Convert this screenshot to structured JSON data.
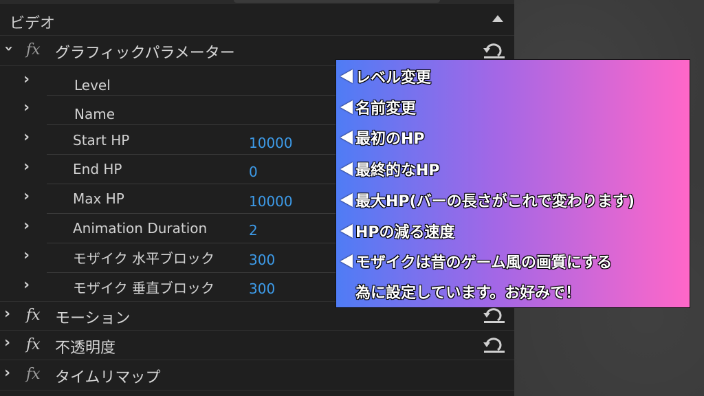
{
  "panel": {
    "section_title": "ビデオ",
    "effects": [
      {
        "name": "グラフィックパラメーター",
        "expanded": true
      },
      {
        "name": "モーション",
        "expanded": false
      },
      {
        "name": "不透明度",
        "expanded": false
      },
      {
        "name": "タイムリマップ",
        "expanded": false
      }
    ],
    "properties": [
      {
        "name": "Level",
        "value": ""
      },
      {
        "name": "Name",
        "value": ""
      },
      {
        "name": "Start HP",
        "value": "10000"
      },
      {
        "name": "End HP",
        "value": "0"
      },
      {
        "name": "Max HP",
        "value": "10000"
      },
      {
        "name": "Animation Duration",
        "value": "2"
      },
      {
        "name": "モザイク 水平ブロック",
        "value": "300"
      },
      {
        "name": "モザイク 垂直ブロック",
        "value": "300"
      }
    ],
    "fx_label": "fx"
  },
  "annotation": {
    "lines": [
      "レベル変更",
      "名前変更",
      "最初のHP",
      "最終的なHP",
      "最大HP(バーの長さがこれで変わります)",
      "HPの減る速度",
      "モザイクは昔のゲーム風の画質にする",
      "為に設定しています。お好みで！"
    ]
  },
  "colors": {
    "value_blue": "#3d9be9",
    "gradient_start": "#4f7cf5",
    "gradient_end": "#ff67c8"
  }
}
